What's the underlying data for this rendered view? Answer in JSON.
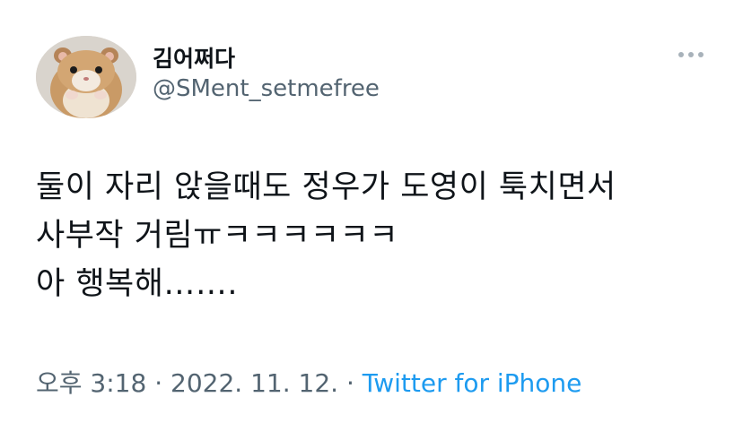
{
  "author": {
    "display_name": "김어쩌다",
    "handle": "@SMent_setmefree",
    "avatar_icon": "hamster-avatar"
  },
  "tweet": {
    "lines": [
      "둘이 자리 앉을때도 정우가 도영이 툭치면서",
      "사부작 거림ㅠㅋㅋㅋㅋㅋㅋ",
      "아 행복해……."
    ]
  },
  "meta": {
    "time": "오후 3:18",
    "sep1": " · ",
    "date": "2022. 11. 12.",
    "sep2": " · ",
    "source": "Twitter for iPhone"
  },
  "colors": {
    "text": "#0f1419",
    "secondary": "#536471",
    "link": "#1d9bf0"
  }
}
